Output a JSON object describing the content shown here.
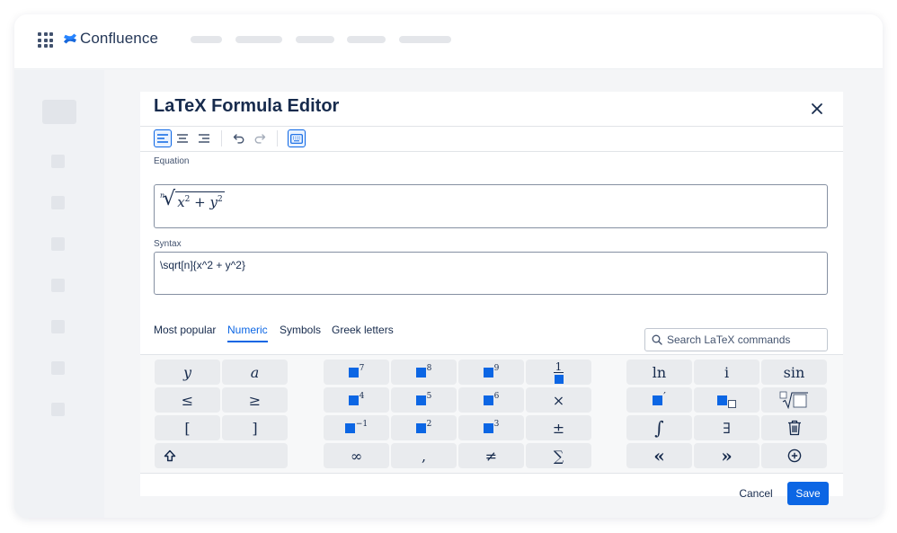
{
  "app": {
    "brand": "Confluence"
  },
  "dialog": {
    "title": "LaTeX Formula Editor",
    "equation_label": "Equation",
    "syntax_label": "Syntax",
    "syntax_value": "\\sqrt[n]{x^2 + y^2}",
    "equation": {
      "index": "n",
      "base1": "x",
      "exp1": "2",
      "op": "+",
      "base2": "y",
      "exp2": "2"
    }
  },
  "tabs": [
    {
      "label": "Most popular",
      "active": false
    },
    {
      "label": "Numeric",
      "active": true
    },
    {
      "label": "Symbols",
      "active": false
    },
    {
      "label": "Greek letters",
      "active": false
    }
  ],
  "search": {
    "placeholder": "Search LaTeX commands"
  },
  "keys": {
    "y": "y",
    "a": "a",
    "le": "≤",
    "ge": "≥",
    "lbracket": "[",
    "rbracket": "]",
    "pow7": "7",
    "pow8": "8",
    "pow9": "9",
    "frac_num": "1",
    "pow4": "4",
    "pow5": "5",
    "pow6": "6",
    "times": "×",
    "powneg1": "−1",
    "pow2": "2",
    "pow3": "3",
    "pm": "±",
    "infty": "∞",
    "comma": ",",
    "neq": "≠",
    "sum": "∑",
    "ln": "ln",
    "i": "i",
    "sin": "sin",
    "prime": "′",
    "integral": "∫",
    "exists": "∃",
    "laquo": "«",
    "raquo": "»"
  },
  "footer": {
    "cancel_label": "Cancel",
    "save_label": "Save"
  },
  "colors": {
    "accent": "#0c66e4",
    "text": "#172b4d",
    "key_bg": "#e9ebee"
  },
  "icons": [
    "apps-grid-icon",
    "confluence-logo-icon",
    "close-icon",
    "align-left-icon",
    "align-center-icon",
    "align-right-icon",
    "undo-icon",
    "redo-icon",
    "keyboard-icon",
    "search-icon",
    "shift-icon",
    "nth-root-icon",
    "trash-icon",
    "add-icon"
  ]
}
